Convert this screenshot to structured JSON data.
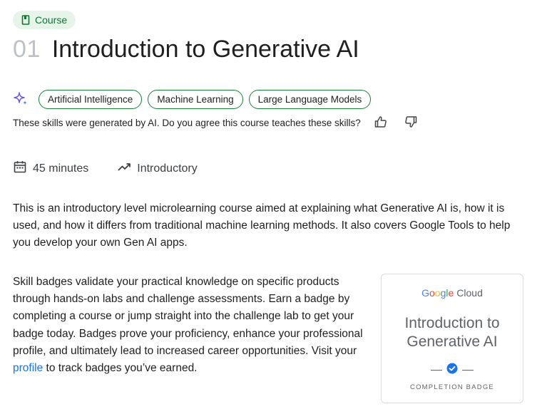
{
  "course_chip": {
    "label": "Course"
  },
  "title": {
    "number": "01",
    "text": "Introduction to Generative AI"
  },
  "skills": [
    "Artificial Intelligence",
    "Machine Learning",
    "Large Language Models"
  ],
  "feedback": {
    "question": "These skills were generated by AI. Do you agree this course teaches these skills?"
  },
  "meta": {
    "duration": "45 minutes",
    "level": "Introductory"
  },
  "description": "This is an introductory level microlearning course aimed at explaining what Generative AI is, how it is used, and how it differs from traditional machine learning methods. It also covers Google Tools to help you develop your own Gen AI apps.",
  "badge_info": {
    "text_before": "Skill badges validate your practical knowledge on specific products through hands-on labs and challenge assessments. Earn a badge by completing a course or jump straight into the challenge lab to get your badge today. Badges prove your proficiency, enhance your professional profile, and ultimately lead to increased career opportunities. Visit your ",
    "link_text": "profile",
    "text_after": " to track badges you’ve earned."
  },
  "badge_card": {
    "brand_google": "Google",
    "brand_cloud": "Cloud",
    "title": "Introduction to Generative AI",
    "label": "COMPLETION BADGE"
  },
  "colors": {
    "accent_green": "#188038",
    "chip_bg": "#e6f4ea",
    "link_blue": "#1a73e8"
  }
}
